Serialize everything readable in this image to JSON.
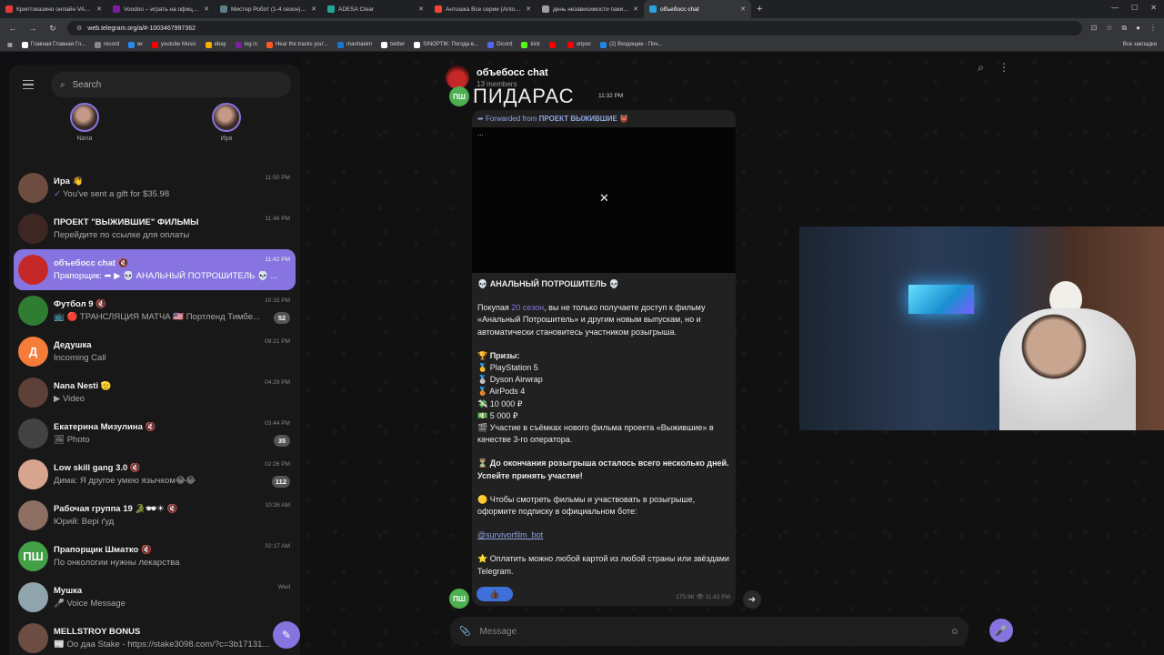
{
  "browser": {
    "tabs": [
      {
        "title": "Криптоказино онлайн VAVADA",
        "color": "#e53935"
      },
      {
        "title": "Voodoo – играть на официаль",
        "color": "#7b1fa2"
      },
      {
        "title": "Мистер Робот (1-4 сезон) сме",
        "color": "#607d8b"
      },
      {
        "title": "ADESA Clear",
        "color": "#26a69a"
      },
      {
        "title": "Антошка Все серии (Antoshka",
        "color": "#f44336"
      },
      {
        "title": "день независимости пакистан",
        "color": "#9e9e9e"
      },
      {
        "title": "объебосс chat",
        "color": "#2aa3df",
        "active": true
      }
    ],
    "url": "web.telegram.org/a/#-1003467997362",
    "bookmarks": [
      {
        "label": "Главная Главная Гл...",
        "color": "#ffffff"
      },
      {
        "label": "record",
        "color": "#888888"
      },
      {
        "label": "вк",
        "color": "#2787f5"
      },
      {
        "label": "youtube Music",
        "color": "#ff0000"
      },
      {
        "label": "ebay",
        "color": "#f5af02"
      },
      {
        "label": "log in",
        "color": "#7b1fa2"
      },
      {
        "label": "Hear the tracks you'...",
        "color": "#ff5722"
      },
      {
        "label": "manhaeim",
        "color": "#1976d2"
      },
      {
        "label": "twitter",
        "color": "#ffffff"
      },
      {
        "label": "SINOPTIK: Погода в...",
        "color": "#ffffff"
      },
      {
        "label": "Dicord",
        "color": "#5865f2"
      },
      {
        "label": "kick",
        "color": "#53fc18"
      },
      {
        "label": "",
        "color": "#ff0000"
      },
      {
        "label": "опрос",
        "color": "#ff0000"
      },
      {
        "label": "(2) Входящие - Поч...",
        "color": "#1e88e5"
      }
    ],
    "all_bookmarks": "Все закладки"
  },
  "sidebar": {
    "search_placeholder": "Search",
    "stories": [
      {
        "name": "Nana"
      },
      {
        "name": "Ира"
      }
    ],
    "chats": [
      {
        "name": "Ира 👋",
        "message": "You've sent a gift for $35.98",
        "time": "11:50 PM",
        "read_check": "✓",
        "avatar_color": "#6d4c41",
        "avatar_text": ""
      },
      {
        "name": "ПРОЕКТ \"ВЫЖИВШИЕ\" ФИЛЬМЫ",
        "message": "Перейдите по ссылке для оплаты",
        "time": "11:46 PM",
        "avatar_color": "#3e2723",
        "avatar_text": ""
      },
      {
        "name": "объебосс chat 🔇",
        "message": "Прапорщик: ➦ ▶ 💀 АНАЛЬНЫЙ ПОТРОШИТЕЛЬ 💀 ...",
        "time": "11:42 PM",
        "active": true,
        "avatar_color": "#c62828",
        "avatar_text": ""
      },
      {
        "name": "Футбол 9 🔇",
        "message": "📺 🔴 ТРАНСЛЯЦИЯ МАТЧА 🇺🇸 Портленд Тимбе...",
        "time": "10:15 PM",
        "badge": "52",
        "avatar_color": "#2e7d32",
        "avatar_text": ""
      },
      {
        "name": "Дедушка",
        "message": "Incoming Call",
        "time": "09:21 PM",
        "avatar_color": "#f57c39",
        "avatar_text": "Д"
      },
      {
        "name": "Nana Nesti 🫡",
        "message": "▶ Video",
        "time": "04:29 PM",
        "avatar_color": "#5d4037",
        "avatar_text": ""
      },
      {
        "name": "Екатерина Мизулина 🔇",
        "message": "🖼 Photo",
        "time": "03:44 PM",
        "badge": "35",
        "avatar_color": "#424242",
        "avatar_text": ""
      },
      {
        "name": "Low skill gang 3.0 🔇",
        "message": "Дима: Я другое умею язычком😂😂",
        "time": "02:26 PM",
        "badge": "112",
        "avatar_color": "#d7a48e",
        "avatar_text": ""
      },
      {
        "name": "Рабочая группа 19 🐊🕶☀ 🔇",
        "message": "Юрий: Вері ґуд",
        "time": "10:26 AM",
        "avatar_color": "#8d6e63",
        "avatar_text": ""
      },
      {
        "name": "Прапорщик Шматко 🔇",
        "message": "По онкологии нужны лекарства",
        "time": "02:17 AM",
        "avatar_color": "#43a047",
        "avatar_text": "ПШ"
      },
      {
        "name": "Мушка",
        "message": "🎤 Voice Message",
        "time": "Wed",
        "avatar_color": "#90a4ae",
        "avatar_text": ""
      },
      {
        "name": "MELLSTROY BONUS",
        "message": "📰 Оо даа Stake - https://stake3098.com/?c=3b17131...",
        "time": "",
        "avatar_color": "#6d4c41",
        "avatar_text": ""
      }
    ]
  },
  "chat": {
    "title": "объебосс chat",
    "members": "13 members",
    "prev_message": "ПИДАРАС",
    "prev_time": "11:32 PM",
    "sender_avatar": "ПШ",
    "forwarded_prefix": "Forwarded from",
    "forwarded_source": "ПРОЕКТ ВЫЖИВШИЕ 👹",
    "media_dots": "...",
    "post_title": "💀 АНАЛЬНЫЙ ПОТРОШИТЕЛЬ 💀",
    "p1_start": "Покупая ",
    "p1_link": "20 сезон",
    "p1_rest": ", вы не только получаете доступ к фильму «Анальный Потрошитель» и другим новым выпускам, но и автоматически становитесь участником розыгрыша.",
    "prizes_title": "🏆 Призы:",
    "prizes": [
      "🥇 PlayStation 5",
      "🥈 Dyson Airwrap",
      "🥉 AirPods 4",
      "💸 10 000 ₽",
      "💵 5 000 ₽",
      "🎬 Участие в съёмках нового фильма проекта «Выжившие» в качестве 3-го оператора."
    ],
    "p3": "⏳ До окончания розыгрыша осталось всего несколько дней. Успейте принять участие!",
    "p4": "🟡 Чтобы смотреть фильмы и участвовать в розыгрыше, оформите подписку в официальном боте:",
    "bot_link": "@survivorfilm_bot",
    "p5": "⭐ Оплатить можно любой картой из любой страны или звёздами Telegram.",
    "reaction": "👍🏿",
    "views": "175.9K",
    "time": "11:42 PM",
    "composer_placeholder": "Message"
  }
}
